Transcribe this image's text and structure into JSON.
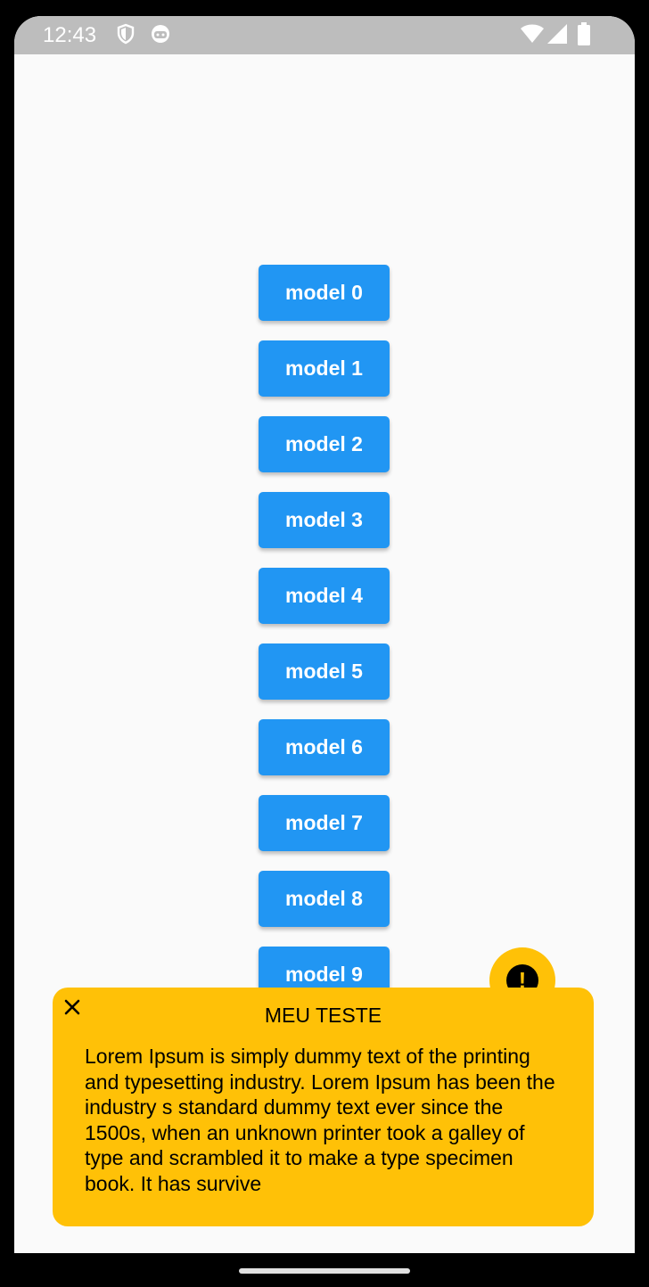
{
  "status_bar": {
    "time": "12:43",
    "icons": [
      "shield-icon",
      "android-face-icon",
      "wifi-icon",
      "cell-signal-icon",
      "battery-icon"
    ]
  },
  "buttons": [
    {
      "label": "model 0"
    },
    {
      "label": "model 1"
    },
    {
      "label": "model 2"
    },
    {
      "label": "model 3"
    },
    {
      "label": "model 4"
    },
    {
      "label": "model 5"
    },
    {
      "label": "model 6"
    },
    {
      "label": "model 7"
    },
    {
      "label": "model 8"
    },
    {
      "label": "model 9"
    }
  ],
  "alert": {
    "icon": "exclamation-icon",
    "fab_glyph": "!",
    "title": "MEU TESTE",
    "close_icon": "close-icon",
    "message": "Lorem Ipsum is simply dummy text of the printing and typesetting industry. Lorem Ipsum has been the industry s standard dummy text ever since the 1500s, when an unknown printer took a galley of type and scrambled it to make a type specimen book. It has survive"
  },
  "colors": {
    "button_blue": "#2196f3",
    "alert_amber": "#ffc107",
    "status_bar_gray": "#bdbdbd",
    "background": "#fafafa"
  }
}
